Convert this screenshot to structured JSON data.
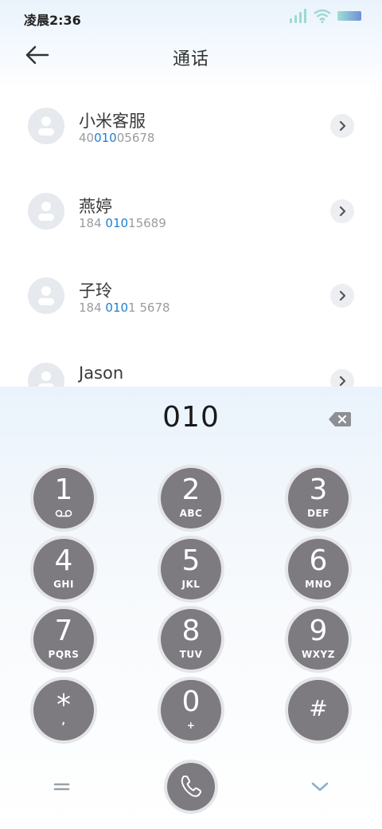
{
  "status_bar": {
    "time": "凌晨2:36"
  },
  "header": {
    "title": "通话",
    "back_icon": "back-arrow-icon"
  },
  "contacts": [
    {
      "name": "小米客服",
      "number_parts": [
        "40",
        "010",
        "05678"
      ]
    },
    {
      "name": "燕婷",
      "number_parts": [
        "184 ",
        "010",
        "15689"
      ]
    },
    {
      "name": "子玲",
      "number_parts": [
        "184 ",
        "010",
        "1 5678"
      ]
    },
    {
      "name": "Jason",
      "number_parts": [
        "",
        "",
        ""
      ]
    }
  ],
  "dialpad": {
    "entered_number": "010",
    "keys": [
      {
        "digit": "1",
        "letters": ""
      },
      {
        "digit": "2",
        "letters": "ABC"
      },
      {
        "digit": "3",
        "letters": "DEF"
      },
      {
        "digit": "4",
        "letters": "GHI"
      },
      {
        "digit": "5",
        "letters": "JKL"
      },
      {
        "digit": "6",
        "letters": "MNO"
      },
      {
        "digit": "7",
        "letters": "PQRS"
      },
      {
        "digit": "8",
        "letters": "TUV"
      },
      {
        "digit": "9",
        "letters": "WXYZ"
      },
      {
        "digit": "*",
        "letters": ","
      },
      {
        "digit": "0",
        "letters": "+"
      },
      {
        "digit": "#",
        "letters": ""
      }
    ]
  },
  "colors": {
    "accent": "#1b7fd6",
    "key_bg": "#7d7a80",
    "header_bg": "#eaf3fc"
  }
}
